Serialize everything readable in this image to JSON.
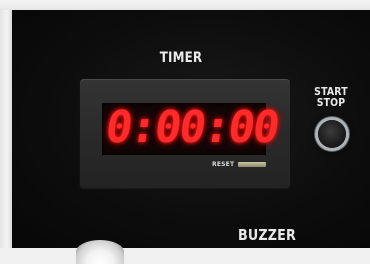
{
  "panel": {
    "timer_label": "TIMER",
    "start_stop_label_line1": "START",
    "start_stop_label_line2": "STOP",
    "buzzer_label": "BUZZER"
  },
  "timer_display": {
    "value": "0:00:00",
    "digit_color": "#ff2a2a",
    "reset_label": "RESET"
  },
  "icons": {
    "start_stop_button": "round-push-button",
    "buzzer_control": "round-knob"
  }
}
